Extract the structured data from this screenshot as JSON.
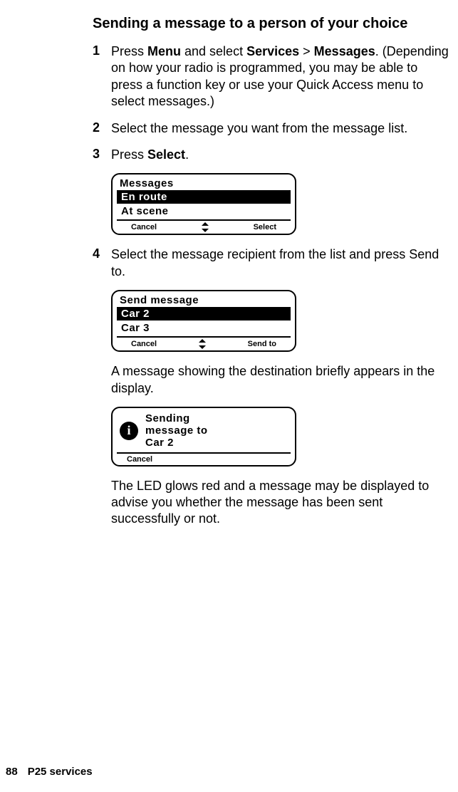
{
  "heading": "Sending a message to a person of your choice",
  "steps": {
    "s1": {
      "num": "1",
      "t1": "Press ",
      "b1": "Menu",
      "t2": " and select ",
      "b2": "Services",
      "t3": " > ",
      "b3": "Messages",
      "t4": ". (Depending on how your radio is programmed, you may be able to press a function key or use your Quick Access menu to select messages.)"
    },
    "s2": {
      "num": "2",
      "text": "Select the message you want from the message list."
    },
    "s3": {
      "num": "3",
      "t1": "Press ",
      "b1": "Select",
      "t2": "."
    },
    "s4": {
      "num": "4",
      "text": "Select the message recipient from the list and press Send to."
    }
  },
  "lcd1": {
    "title": "Messages",
    "row1": "En route",
    "row2": "At scene",
    "softLeft": "Cancel",
    "softRight": "Select"
  },
  "lcd2": {
    "title": "Send message",
    "row1": "Car 2",
    "row2": "Car 3",
    "softLeft": "Cancel",
    "softRight": "Send to"
  },
  "para1": "A message showing the destination briefly appears in the display.",
  "lcd3": {
    "line1": "Sending",
    "line2": "message to",
    "line3": "Car 2",
    "softLeft": "Cancel"
  },
  "para2": "The LED glows red and a message may be displayed to advise you whether the message has been sent successfully or not.",
  "footer": {
    "page": "88",
    "section": "P25 services"
  }
}
